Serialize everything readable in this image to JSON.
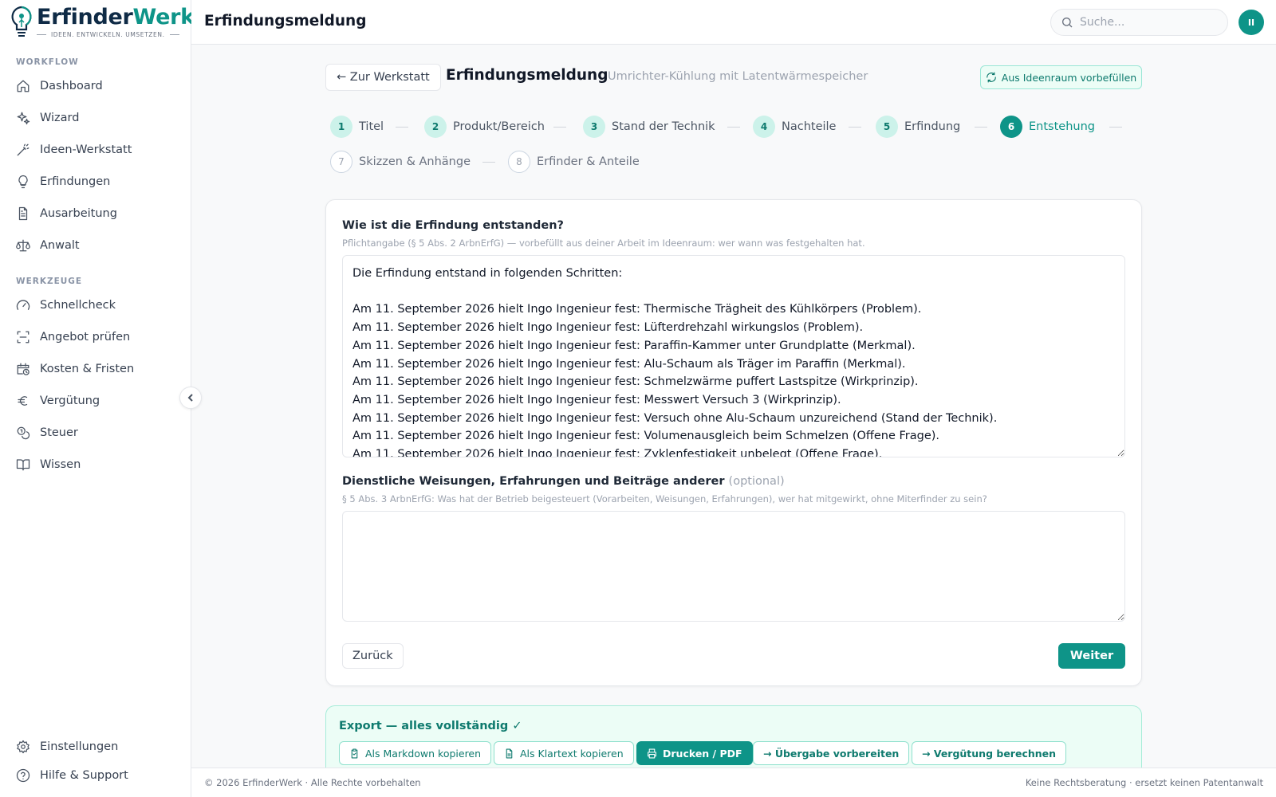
{
  "app": {
    "logo_name_a": "Erfinder",
    "logo_name_b": "Werk",
    "logo_tagline": "IDEEN. ENTWICKELN. UMSETZEN.",
    "accent": "#0e9488"
  },
  "header": {
    "title": "Erfindungsmeldung",
    "search_placeholder": "Suche...",
    "avatar_initials": "II"
  },
  "sidebar": {
    "workflow_label": "WORKFLOW",
    "workflow": [
      {
        "label": "Dashboard",
        "icon": "home-icon"
      },
      {
        "label": "Wizard",
        "icon": "sparkles-icon"
      },
      {
        "label": "Ideen-Werkstatt",
        "icon": "magic-wand-icon"
      },
      {
        "label": "Erfindungen",
        "icon": "lightbulb-icon"
      },
      {
        "label": "Ausarbeitung",
        "icon": "document-icon"
      },
      {
        "label": "Anwalt",
        "icon": "scale-icon"
      }
    ],
    "tools_label": "WERKZEUGE",
    "tools": [
      {
        "label": "Schnellcheck",
        "icon": "gauge-icon"
      },
      {
        "label": "Angebot prüfen",
        "icon": "scan-icon"
      },
      {
        "label": "Kosten & Fristen",
        "icon": "calendar-clock-icon"
      },
      {
        "label": "Vergütung",
        "icon": "euro-icon"
      },
      {
        "label": "Steuer",
        "icon": "coins-icon"
      },
      {
        "label": "Wissen",
        "icon": "book-icon"
      }
    ],
    "bottom": [
      {
        "label": "Einstellungen",
        "icon": "gear-icon"
      },
      {
        "label": "Hilfe & Support",
        "icon": "help-circle-icon"
      }
    ]
  },
  "page": {
    "back_label": "← Zur Werkstatt",
    "title": "Erfindungsmeldung",
    "subtitle": "Umrichter-Kühlung mit Latentwärmespeicher",
    "prefill_label": "Aus Ideenraum vorbefüllen"
  },
  "steps": [
    {
      "num": "1",
      "label": "Titel",
      "state": "done"
    },
    {
      "num": "2",
      "label": "Produkt/Bereich",
      "state": "done"
    },
    {
      "num": "3",
      "label": "Stand der Technik",
      "state": "done"
    },
    {
      "num": "4",
      "label": "Nachteile",
      "state": "done"
    },
    {
      "num": "5",
      "label": "Erfindung",
      "state": "done"
    },
    {
      "num": "6",
      "label": "Entstehung",
      "state": "active"
    },
    {
      "num": "7",
      "label": "Skizzen & Anhänge",
      "state": "todo"
    },
    {
      "num": "8",
      "label": "Erfinder & Anteile",
      "state": "todo"
    }
  ],
  "form": {
    "field1_label": "Wie ist die Erfindung entstanden?",
    "field1_hint": "Pflichtangabe (§ 5 Abs. 2 ArbnErfG) — vorbefüllt aus deiner Arbeit im Ideenraum: wer wann was festgehalten hat.",
    "field1_value": "Die Erfindung entstand in folgenden Schritten:\n\nAm 11. September 2026 hielt Ingo Ingenieur fest: Thermische Trägheit des Kühlkörpers (Problem).\nAm 11. September 2026 hielt Ingo Ingenieur fest: Lüfterdrehzahl wirkungslos (Problem).\nAm 11. September 2026 hielt Ingo Ingenieur fest: Paraffin-Kammer unter Grundplatte (Merkmal).\nAm 11. September 2026 hielt Ingo Ingenieur fest: Alu-Schaum als Träger im Paraffin (Merkmal).\nAm 11. September 2026 hielt Ingo Ingenieur fest: Schmelzwärme puffert Lastspitze (Wirkprinzip).\nAm 11. September 2026 hielt Ingo Ingenieur fest: Messwert Versuch 3 (Wirkprinzip).\nAm 11. September 2026 hielt Ingo Ingenieur fest: Versuch ohne Alu-Schaum unzureichend (Stand der Technik).\nAm 11. September 2026 hielt Ingo Ingenieur fest: Volumenausgleich beim Schmelzen (Offene Frage).\nAm 11. September 2026 hielt Ingo Ingenieur fest: Zyklenfestigkeit unbelegt (Offene Frage).",
    "field2_label": "Dienstliche Weisungen, Erfahrungen und Beiträge anderer",
    "field2_optional": "(optional)",
    "field2_hint": "§ 5 Abs. 3 ArbnErfG: Was hat der Betrieb beigesteuert (Vorarbeiten, Weisungen, Erfahrungen), wer hat mitgewirkt, ohne Miterfinder zu sein?",
    "field2_value": "",
    "back_button": "Zurück",
    "next_button": "Weiter"
  },
  "export": {
    "title": "Export — alles vollständig ✓",
    "buttons": [
      {
        "label": "Als Markdown kopieren",
        "icon": "clipboard-icon"
      },
      {
        "label": "Als Klartext kopieren",
        "icon": "file-text-icon"
      },
      {
        "label": "Drucken / PDF",
        "icon": "printer-icon"
      },
      {
        "label": "→ Übergabe vorbereiten",
        "icon": ""
      },
      {
        "label": "→ Vergütung berechnen",
        "icon": ""
      }
    ]
  },
  "footer": {
    "left": "© 2026 ErfinderWerk · Alle Rechte vorbehalten",
    "right": "Keine Rechtsberatung · ersetzt keinen Patentanwalt"
  }
}
